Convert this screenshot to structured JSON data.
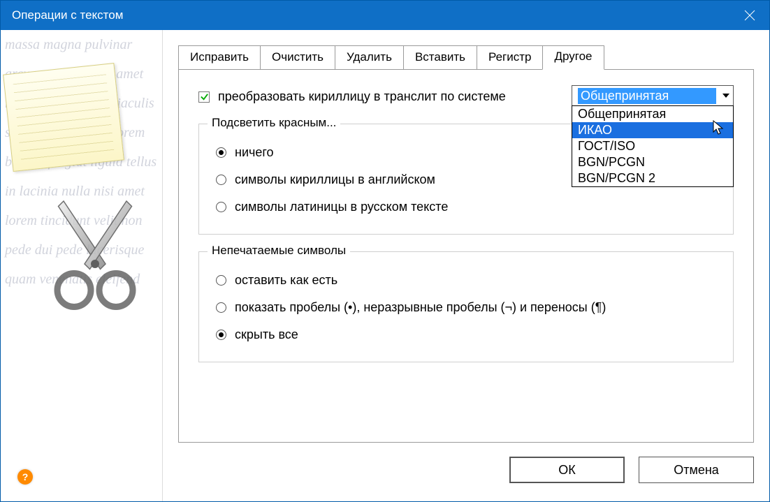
{
  "window": {
    "title": "Операции с текстом"
  },
  "tabs": [
    {
      "label": "Исправить",
      "active": false
    },
    {
      "label": "Очистить",
      "active": false
    },
    {
      "label": "Удалить",
      "active": false
    },
    {
      "label": "Вставить",
      "active": false
    },
    {
      "label": "Регистр",
      "active": false
    },
    {
      "label": "Другое",
      "active": true
    }
  ],
  "translit": {
    "checkbox_label": "преобразовать кириллицу в транслит по системе",
    "checked": true,
    "selected": "Общепринятая",
    "options": [
      "Общепринятая",
      "ИКАО",
      "ГОСТ/ISO",
      "BGN/PCGN",
      "BGN/PCGN 2"
    ],
    "highlighted_index": 1
  },
  "highlight_group": {
    "legend": "Подсветить красным...",
    "options": [
      {
        "label": "ничего",
        "selected": true
      },
      {
        "label": "символы кириллицы в английском",
        "selected": false
      },
      {
        "label": "символы латиницы в русском тексте",
        "selected": false
      }
    ]
  },
  "nonprint_group": {
    "legend": "Непечатаемые символы",
    "options": [
      {
        "label": "оставить как есть",
        "selected": false
      },
      {
        "label": "показать пробелы (•), неразрывные пробелы (¬) и переносы (¶)",
        "selected": false
      },
      {
        "label": "скрыть все",
        "selected": true
      }
    ]
  },
  "buttons": {
    "ok": "ОК",
    "cancel": "Отмена"
  },
  "sidebar_decor_text": "massa magna pulvinar arcu nunc ullam sit amet massa ut arcu nunc iaculis sit amet a placerat lorem blandit feugiat ligula tellus in lacinia nulla nisi amet lorem tincidunt velit non pede dui pede lacerisque quam venenatis eleifend"
}
